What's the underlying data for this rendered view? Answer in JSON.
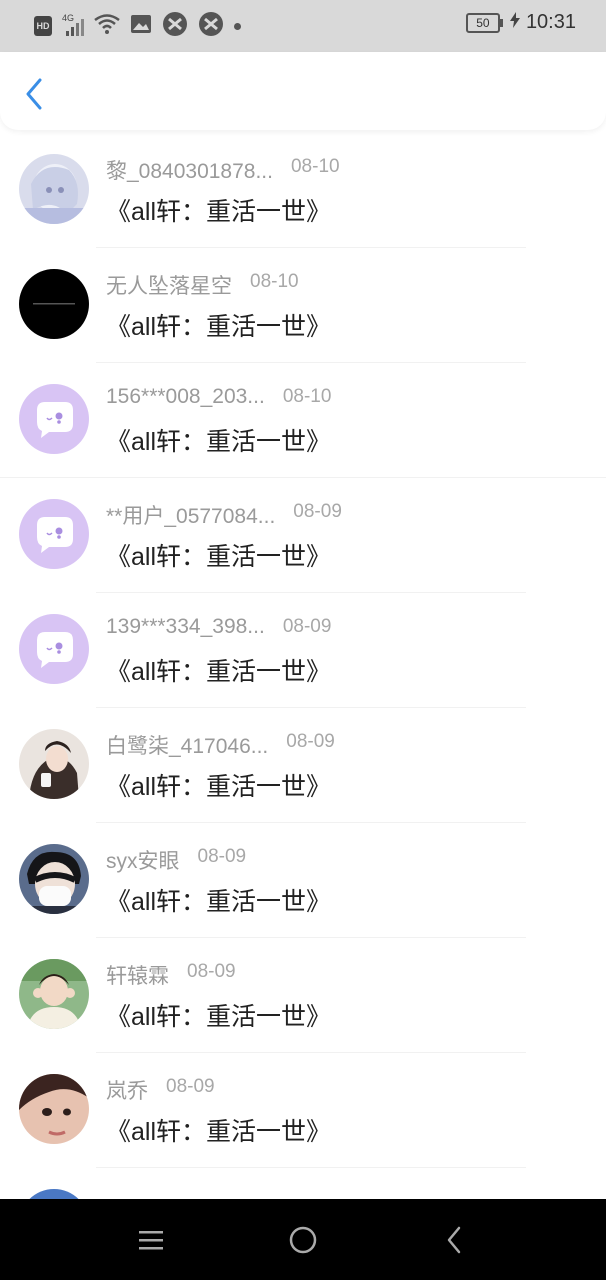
{
  "status_bar": {
    "time": "10:31",
    "battery": "50",
    "hd_label": "HD",
    "network_label": "4G"
  },
  "header": {
    "back_icon": "chevron-left-icon",
    "accent_color": "#3a8ee6"
  },
  "messages": [
    {
      "name": "黎_0840301878...",
      "date": "08-10",
      "title": "《all轩：重活一世》",
      "avatar": "anime-girl"
    },
    {
      "name": "无人坠落星空",
      "date": "08-10",
      "title": "《all轩：重活一世》",
      "avatar": "black"
    },
    {
      "name": "156***008_203...",
      "date": "08-10",
      "title": "《all轩：重活一世》",
      "avatar": "default-chat"
    },
    {
      "name": "**用户_0577084...",
      "date": "08-09",
      "title": "《all轩：重活一世》",
      "avatar": "default-chat"
    },
    {
      "name": "139***334_398...",
      "date": "08-09",
      "title": "《all轩：重活一世》",
      "avatar": "default-chat"
    },
    {
      "name": "白鹭柒_417046...",
      "date": "08-09",
      "title": "《all轩：重活一世》",
      "avatar": "photo-girl"
    },
    {
      "name": "syx安眼",
      "date": "08-09",
      "title": "《all轩：重活一世》",
      "avatar": "photo-mask"
    },
    {
      "name": "轩辕霖",
      "date": "08-09",
      "title": "《all轩：重活一世》",
      "avatar": "photo-outdoor"
    },
    {
      "name": "岚乔",
      "date": "08-09",
      "title": "《all轩：重活一世》",
      "avatar": "photo-face"
    },
    {
      "name": "",
      "date": "",
      "title": "",
      "avatar": "partial-blue"
    }
  ],
  "nav": {
    "menu_icon": "menu-icon",
    "home_icon": "home-circle-icon",
    "back_icon": "back-triangle-icon"
  }
}
